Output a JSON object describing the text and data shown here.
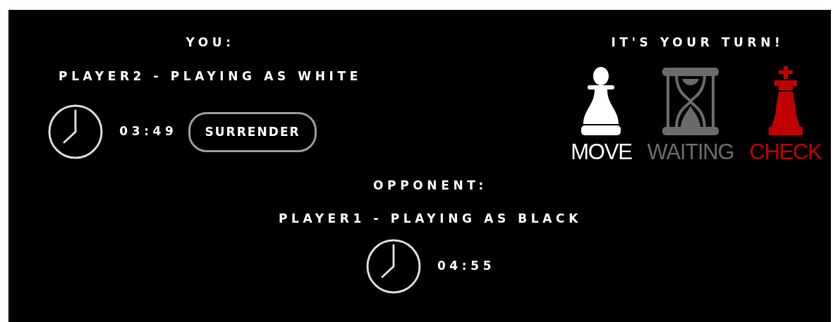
{
  "you": {
    "heading": "YOU:",
    "player": "PLAYER2 - PLAYING AS WHITE",
    "clock": "03:49",
    "button": "SURRENDER"
  },
  "turn": {
    "heading": "IT'S YOUR TURN!",
    "indicators": [
      {
        "kind": "pawn",
        "label": "MOVE",
        "color": "#ffffff"
      },
      {
        "kind": "hourglass",
        "label": "WAITING",
        "color": "#6b6b6b"
      },
      {
        "kind": "king",
        "label": "CHECK",
        "color": "#c00000"
      }
    ]
  },
  "opponent": {
    "heading": "OPPONENT:",
    "player": "PLAYER1 - PLAYING AS BLACK",
    "clock": "04:55"
  }
}
